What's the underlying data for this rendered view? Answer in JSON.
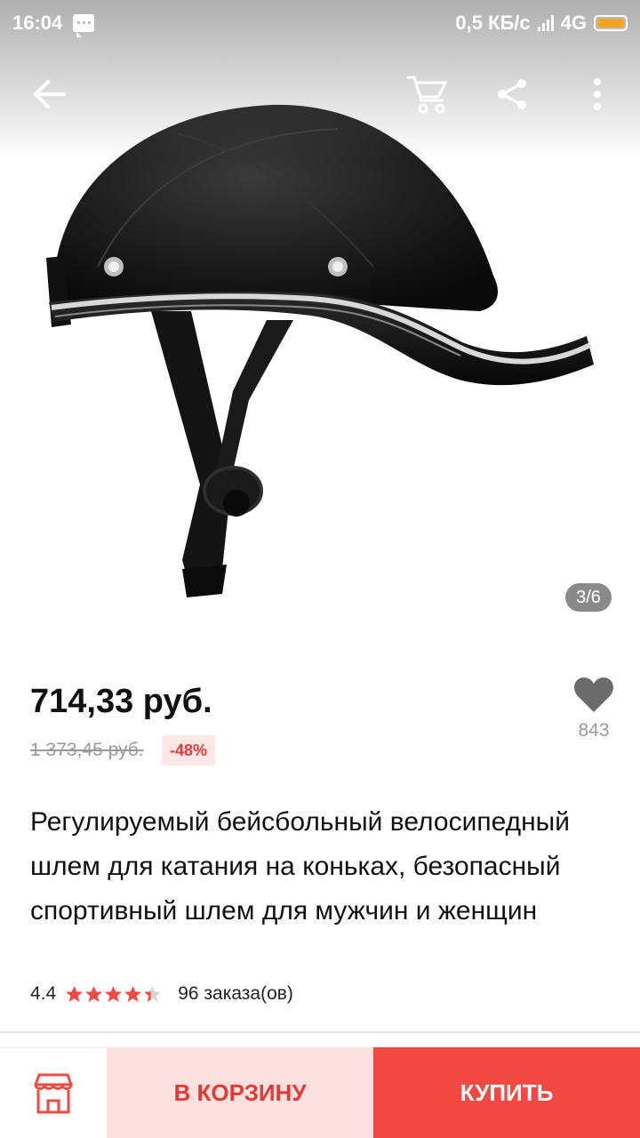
{
  "status_bar": {
    "time": "16:04",
    "speed": "0,5 КБ/с",
    "network": "4G",
    "icons": [
      "message-icon",
      "signal-icon",
      "battery-icon"
    ]
  },
  "toolbar": {
    "icons": [
      "back-arrow-icon",
      "cart-icon",
      "share-icon",
      "more-vertical-icon"
    ]
  },
  "gallery": {
    "counter": "3/6",
    "image": "baseball-cap-helmet-product-image"
  },
  "product": {
    "price": "714,33 руб.",
    "old_price": "1 373,45 руб.",
    "discount": "-48%",
    "wishlist_count": "843",
    "title": "Регулируемый бейсбольный велосипедный шлем для катания на коньках, безопасный спортивный шлем для мужчин и женщин",
    "rating": "4.4",
    "rating_value": 4.4,
    "rating_max": 5,
    "orders": "96 заказа(ов)"
  },
  "bottom_bar": {
    "store_icon": "store-icon",
    "add_to_cart_label": "В КОРЗИНУ",
    "buy_label": "КУПИТЬ"
  },
  "colors": {
    "accent": "#f44842",
    "accent_light": "#fde0e0",
    "discount_text": "#e53935",
    "star": "#f44842"
  }
}
